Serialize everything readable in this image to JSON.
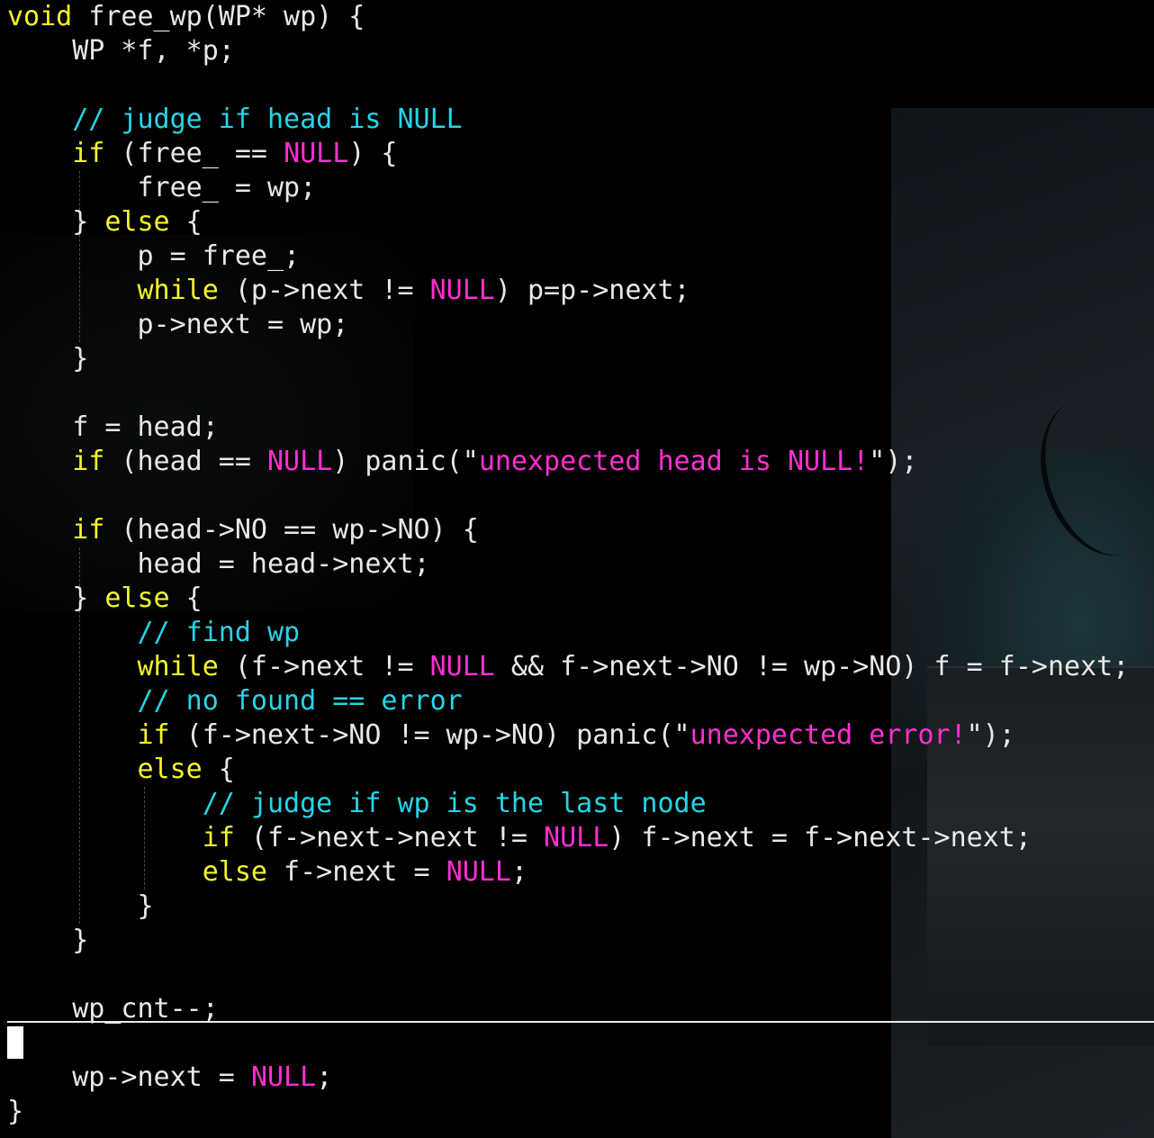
{
  "editor": {
    "lines": [
      "void free_wp(WP* wp) {",
      "    WP *f, *p;",
      "",
      "    // judge if head is NULL",
      "    if (free_ == NULL) {",
      "        free_ = wp;",
      "    } else {",
      "        p = free_;",
      "        while (p->next != NULL) p=p->next;",
      "        p->next = wp;",
      "    }",
      "",
      "    f = head;",
      "    if (head == NULL) panic(\"unexpected head is NULL!\");",
      "",
      "    if (head->NO == wp->NO) {",
      "        head = head->next;",
      "    } else {",
      "        // find wp",
      "        while (f->next != NULL && f->next->NO != wp->NO) f = f->next;",
      "        // no found == error",
      "        if (f->next->NO != wp->NO) panic(\"unexpected error!\");",
      "        else {",
      "            // judge if wp is the last node",
      "            if (f->next->next != NULL) f->next = f->next->next;",
      "            else f->next = NULL;",
      "        }",
      "    }",
      "",
      "    wp_cnt--;",
      "",
      "    wp->next = NULL;",
      "}"
    ],
    "cursor_line": 30,
    "colors": {
      "keyword": "#f5f52a",
      "null_literal": "#ff2fd0",
      "string": "#ff2fd0",
      "comment": "#26d5e8",
      "text": "#e8e8e8",
      "background": "#000000"
    }
  }
}
